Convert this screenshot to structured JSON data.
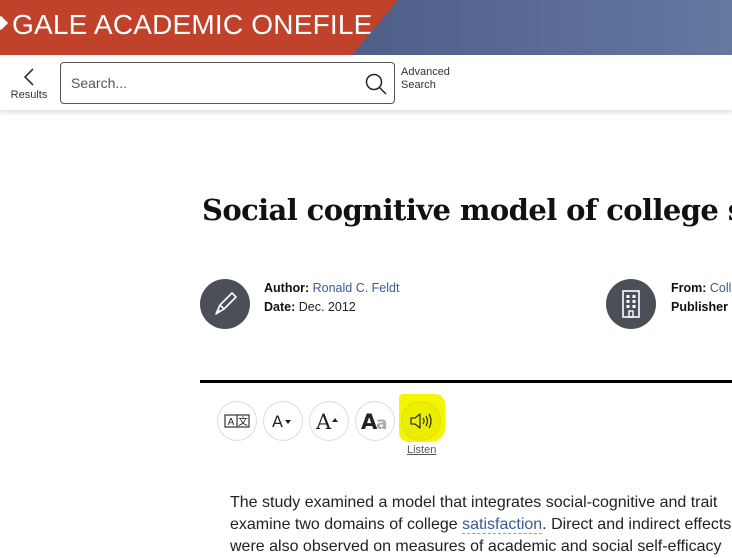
{
  "banner": {
    "title": "GALE ACADEMIC ONEFILE",
    "colors": {
      "red": "#c0422b",
      "blue": "#4b5b85"
    }
  },
  "toolbar": {
    "back_label": "Results",
    "search_placeholder": "Search...",
    "search_value": "",
    "advanced_line1": "Advanced",
    "advanced_line2": "Search"
  },
  "article": {
    "title": "Social cognitive model of college satisfaction",
    "author_label": "Author:",
    "author_value": "Ronald C. Feldt",
    "date_label": "Date:",
    "date_value": "Dec. 2012",
    "from_label": "From:",
    "from_value": "College Student Journal",
    "publisher_label": "Publisher"
  },
  "tools": [
    {
      "name": "translate",
      "icon": "translate-icon"
    },
    {
      "name": "decrease-font",
      "icon": "font-decrease-icon"
    },
    {
      "name": "increase-font",
      "icon": "font-increase-icon"
    },
    {
      "name": "font-style",
      "icon": "font-style-icon"
    },
    {
      "name": "listen",
      "icon": "speaker-icon",
      "label": "Listen",
      "highlight": "#f5f500"
    }
  ],
  "body": {
    "line1": "The study examined a model that integrates social-cognitive and trait",
    "line2_before": "examine two domains of college ",
    "line2_link": "satisfaction",
    "line2_after": ". Direct and indirect effects",
    "line3": "were also observed on measures of academic and social self-efficacy"
  }
}
